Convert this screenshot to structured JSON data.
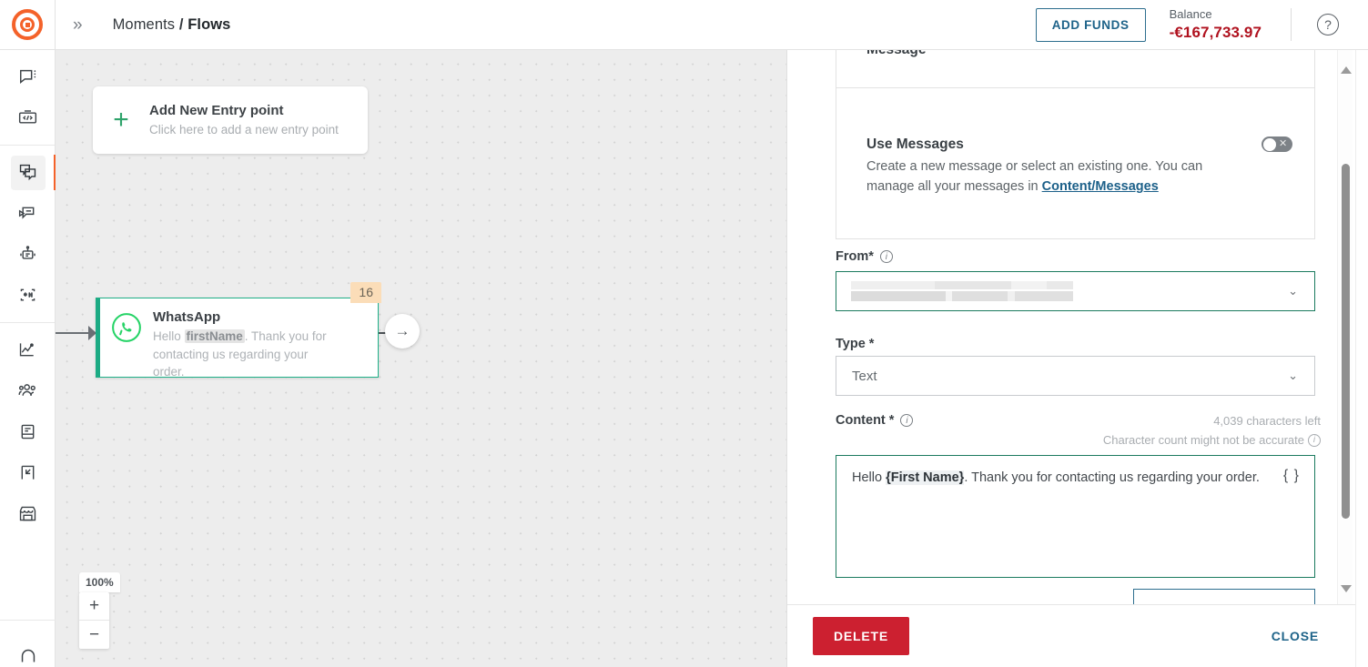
{
  "topbar": {
    "logo_icon": "infobip-logo-icon",
    "expand_icon": "chevron-double-right-icon",
    "breadcrumb_parent": "Moments",
    "breadcrumb_separator": "/",
    "breadcrumb_current": "Flows",
    "add_funds_label": "ADD FUNDS",
    "balance_label": "Balance",
    "balance_value": "-€167,733.97",
    "balance_color": "#b0121f",
    "help_icon": "question-mark-circle-icon",
    "help_glyph": "?"
  },
  "rail": {
    "groups": [
      {
        "items": [
          {
            "name": "conversations",
            "icon": "chat-bubble-menu-icon"
          },
          {
            "name": "developer-tools",
            "icon": "code-brackets-box-icon"
          }
        ]
      },
      {
        "items": [
          {
            "name": "moments",
            "icon": "overlapping-chat-windows-icon",
            "active": true
          },
          {
            "name": "broadcasts",
            "icon": "paper-fold-send-icon"
          },
          {
            "name": "answers-bot",
            "icon": "robot-icon"
          },
          {
            "name": "keywords",
            "icon": "asterisk-hash-scan-icon"
          }
        ]
      },
      {
        "items": [
          {
            "name": "analyze",
            "icon": "line-chart-icon"
          },
          {
            "name": "people",
            "icon": "people-group-icon"
          },
          {
            "name": "content",
            "icon": "book-icon"
          },
          {
            "name": "exit-flow",
            "icon": "exit-arrow-icon"
          },
          {
            "name": "storefront",
            "icon": "storefront-icon"
          }
        ]
      }
    ],
    "bottom_icon": "notification-bell-icon"
  },
  "canvas": {
    "entry_card": {
      "plus_icon": "plus-icon",
      "title": "Add New Entry point",
      "subtitle": "Click here to add a new entry point"
    },
    "node": {
      "icon": "whatsapp-icon",
      "title": "WhatsApp",
      "desc_prefix": "Hello ",
      "desc_placeholder": "firstName",
      "desc_suffix": ". Thank you for contacting us regarding your order.",
      "badge": "16",
      "badge_color": "#fbddb8",
      "accent_color": "#1cab84",
      "next_icon": "arrow-right-icon",
      "next_glyph": "→"
    },
    "zoom": {
      "level": "100%",
      "zoom_in_label": "+",
      "zoom_out_label": "−",
      "zoom_in_icon": "plus-icon",
      "zoom_out_icon": "minus-icon"
    }
  },
  "panel": {
    "message_card": {
      "title": "Message",
      "collapse_icon": "chevron-up-icon",
      "collapse_glyph": "⌃"
    },
    "use_messages": {
      "title": "Use Messages",
      "desc_prefix": "Create a new message or select an existing one. You can manage all your messages in ",
      "link_text": "Content/Messages",
      "toggle_state": "off",
      "toggle_icon": "toggle-off-icon",
      "toggle_glyph": "✕"
    },
    "from_field": {
      "label": "From*",
      "info_icon": "info-circle-icon",
      "value": "",
      "redacted": true,
      "chevron_icon": "chevron-down-icon",
      "chevron_glyph": "⌄"
    },
    "type_field": {
      "label": "Type *",
      "value": "Text",
      "chevron_icon": "chevron-down-icon",
      "chevron_glyph": "⌄"
    },
    "content_field": {
      "label": "Content *",
      "info_icon": "info-circle-icon",
      "chars_left": "4,039 characters left",
      "count_note": "Character count might not be accurate",
      "note_info_icon": "info-circle-icon",
      "text_prefix": "Hello ",
      "text_placeholder": "{First Name}",
      "text_suffix": ". Thank you for contacting us regarding your order.",
      "braces_icon": "curly-braces-icon",
      "braces_glyph": "{ }"
    },
    "footer": {
      "delete_label": "DELETE",
      "delete_color": "#cc2030",
      "close_label": "CLOSE",
      "close_color": "#1e6389"
    },
    "scrollbar": {
      "up_icon": "scroll-up-arrow-icon",
      "down_icon": "scroll-down-arrow-icon",
      "thumb_icon": "scrollbar-thumb"
    }
  }
}
